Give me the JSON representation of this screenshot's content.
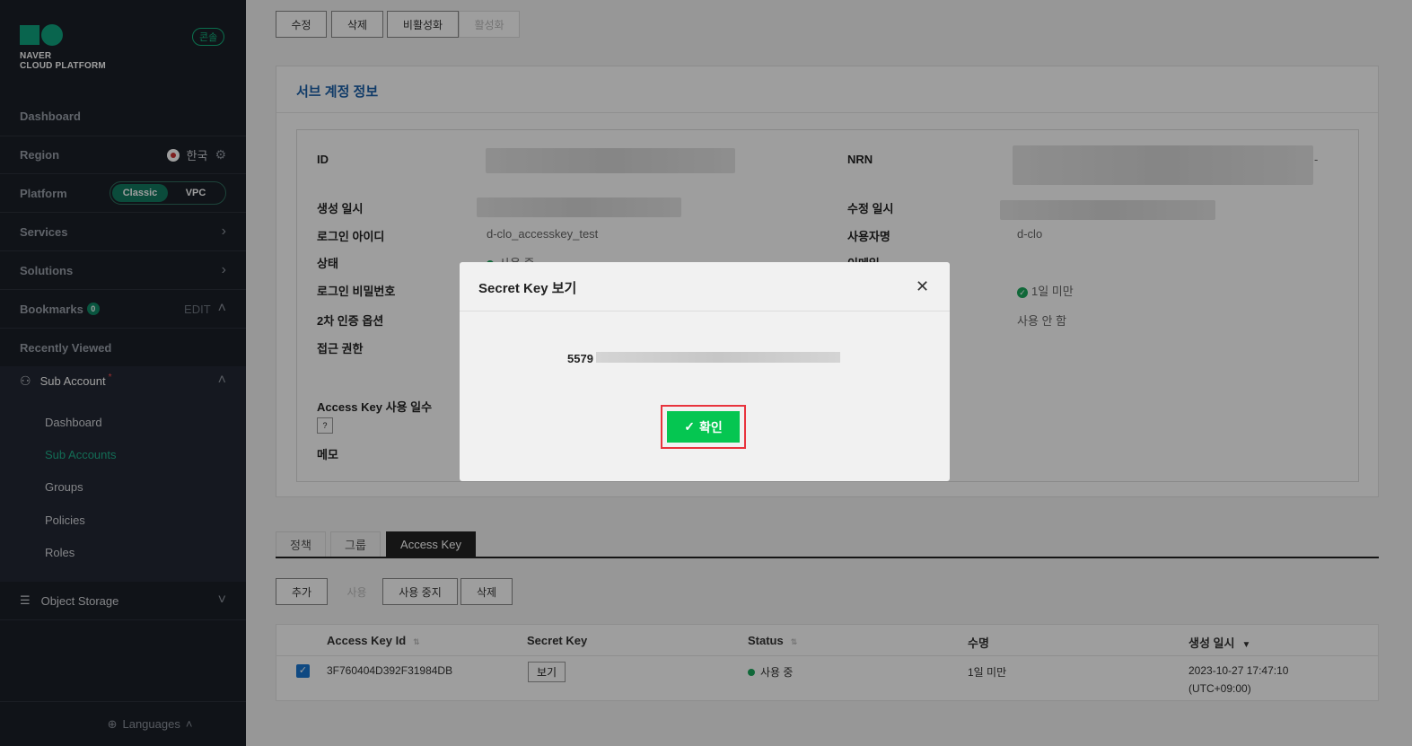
{
  "sidebar": {
    "brand": {
      "line1": "NAVER",
      "line2": "CLOUD PLATFORM"
    },
    "console_badge": "콘솔",
    "dashboard": "Dashboard",
    "region": {
      "label": "Region",
      "value": "한국"
    },
    "platform": {
      "label": "Platform",
      "options": [
        "Classic",
        "VPC"
      ],
      "selected": "Classic"
    },
    "services": "Services",
    "solutions": "Solutions",
    "bookmarks": {
      "label": "Bookmarks",
      "count": "0",
      "edit": "EDIT"
    },
    "recently_viewed": "Recently Viewed",
    "sub_account": {
      "label": "Sub Account",
      "marker": "*",
      "items": [
        {
          "label": "Dashboard"
        },
        {
          "label": "Sub Accounts"
        },
        {
          "label": "Groups"
        },
        {
          "label": "Policies"
        },
        {
          "label": "Roles"
        }
      ],
      "active": "Sub Accounts"
    },
    "object_storage": "Object Storage",
    "languages": "Languages"
  },
  "toolbar": {
    "edit": "수정",
    "delete": "삭제",
    "deactivate": "비활성화",
    "activate": "활성화"
  },
  "account_info": {
    "title": "서브 계정 정보",
    "labels": {
      "id": "ID",
      "nrn": "NRN",
      "created": "생성 일시",
      "modified": "수정 일시",
      "login_id": "로그인 아이디",
      "username": "사용자명",
      "status": "상태",
      "email": "이메일",
      "login_password": "로그인 비밀번호",
      "mfa": "2차 인증 옵션",
      "access_rights": "접근 권한",
      "access_key_days": "Access Key 사용 일수",
      "memo": "메모"
    },
    "values": {
      "login_id": "d-clo_accesskey_test",
      "username": "d-clo",
      "status": "사용 중",
      "password_age": "1일 미만",
      "mfa": "사용 안 함",
      "nrn_suffix": "-",
      "help_icon": "?"
    }
  },
  "tabs": [
    {
      "label": "정책"
    },
    {
      "label": "그룹"
    },
    {
      "label": "Access Key"
    }
  ],
  "key_actions": {
    "add": "추가",
    "use": "사용",
    "stop": "사용 중지",
    "delete": "삭제"
  },
  "table": {
    "columns": [
      "Access Key Id",
      "Secret Key",
      "Status",
      "수명",
      "생성 일시"
    ],
    "rows": [
      {
        "access_key_id": "3F760404D392F31984DB",
        "secret_key_action": "보기",
        "status": "사용 중",
        "lifetime": "1일 미만",
        "created_date": "2023-10-27 17:47:10",
        "created_tz": "(UTC+09:00)"
      }
    ]
  },
  "modal": {
    "title": "Secret Key 보기",
    "secret_visible_prefix": "5579",
    "confirm": "확인"
  },
  "colors": {
    "accent": "#0fa37f",
    "confirm": "#05c651",
    "highlight": "#e8333d",
    "link": "#1a5fa8"
  }
}
